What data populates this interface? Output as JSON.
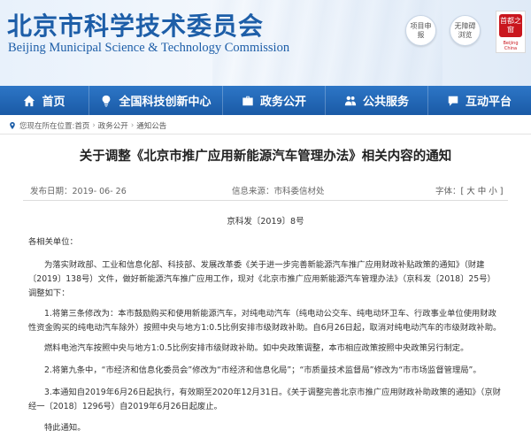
{
  "header": {
    "site_name_cn": "北京市科学技术委员会",
    "site_name_en": "Beijing Municipal Science & Technology Commission",
    "buttons": [
      {
        "label": "项目申报",
        "icon": "project-icon"
      },
      {
        "label": "无障碍浏览",
        "icon": "accessibility-icon"
      }
    ],
    "emblem_text": "首都之窗",
    "emblem_sub": "Beijing China"
  },
  "nav": {
    "items": [
      {
        "label": "首页",
        "icon": "home-icon"
      },
      {
        "label": "全国科技创新中心",
        "icon": "lightbulb-icon"
      },
      {
        "label": "政务公开",
        "icon": "briefcase-icon"
      },
      {
        "label": "公共服务",
        "icon": "people-icon"
      },
      {
        "label": "互动平台",
        "icon": "chat-icon"
      }
    ]
  },
  "breadcrumb": {
    "prefix": "您现在所在位置:",
    "items": [
      "首页",
      "政务公开",
      "通知公告"
    ]
  },
  "article": {
    "title": "关于调整《北京市推广应用新能源汽车管理办法》相关内容的通知",
    "publish_date_label": "发布日期：",
    "publish_date": "2019- 06- 26",
    "source_label": "信息来源：",
    "source": "市科委信材处",
    "font_size_label": "字体：",
    "font_size_options": "[ 大 中 小 ]",
    "doc_number": "京科发〔2019〕8号",
    "salutation": "各相关单位：",
    "paragraphs": [
      "为落实财政部、工业和信息化部、科技部、发展改革委《关于进一步完善新能源汽车推广应用财政补贴政策的通知》（财建〔2019〕138号）文件，做好新能源汽车推广应用工作，现对《北京市推广应用新能源汽车管理办法》（京科发〔2018〕25号）调整如下：",
      "1.将第三条修改为：本市鼓励购买和使用新能源汽车，对纯电动汽车（纯电动公交车、纯电动环卫车、行政事业单位使用财政性资金购买的纯电动汽车除外）按照中央与地方1:0.5比例安排市级财政补助。自6月26日起，取消对纯电动汽车的市级财政补助。",
      "燃料电池汽车按照中央与地方1:0.5比例安排市级财政补助。如中央政策调整，本市相应政策按照中央政策另行制定。",
      "2.将第九条中，“市经济和信息化委员会”修改为“市经济和信息化局”；“市质量技术监督局”修改为“市市场监督管理局”。",
      "3.本通知自2019年6月26日起执行，有效期至2020年12月31日。《关于调整完善北京市推广应用财政补助政策的通知》（京财经一〔2018〕1296号）自2019年6月26日起废止。",
      "特此通知。"
    ]
  },
  "colors": {
    "brand_blue": "#1d5ea8",
    "nav_blue": "#1a5aa6",
    "emblem_red": "#c9161d"
  }
}
